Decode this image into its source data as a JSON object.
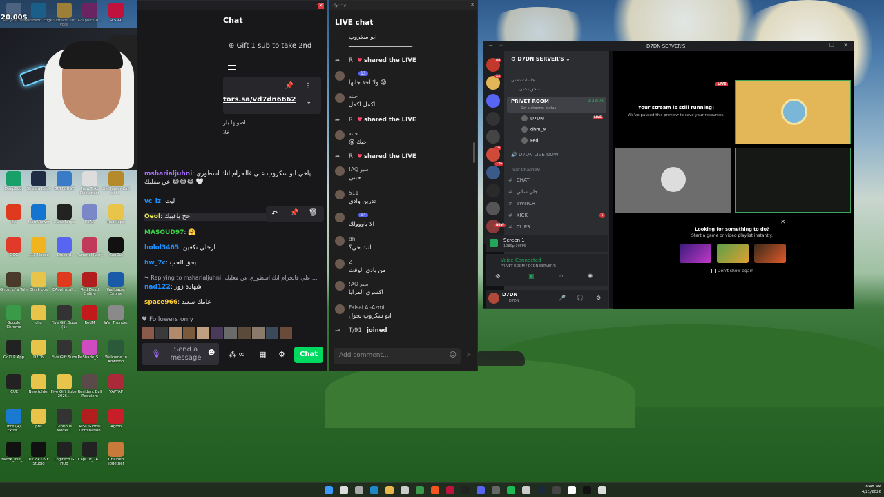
{
  "colors": {
    "chat_bg": "#18181b",
    "accent_green": "#00d95f",
    "twitch_purple": "#a970ff",
    "discord_bg": "#111214",
    "live_red": "#e0245e",
    "stream_yellow": "#e3b758"
  },
  "desktop": {
    "corner_overlay": "20.00$",
    "icons": [
      {
        "label": "Recycle Bin",
        "icon": "recycle-bin-icon",
        "color": "#6b8fb8"
      },
      {
        "label": "Microsoft Edge",
        "icon": "edge-icon",
        "color": "#1e88c9"
      },
      {
        "label": "Vidraclo em voce",
        "icon": "folder-icon",
        "color": "#e8b84a"
      },
      {
        "label": "Graphics-R...",
        "icon": "winrar-icon",
        "color": "#9b2c8c"
      },
      {
        "label": "SLS AC",
        "icon": "sls-icon",
        "color": "#c0123d"
      },
      {
        "label": "DeepCool",
        "icon": "deepcool-icon",
        "color": "#18a06a"
      },
      {
        "label": "Stream Deck",
        "icon": "streamdeck-icon",
        "color": "#202c44"
      },
      {
        "label": "GUFFBUST",
        "icon": "app-icon",
        "color": "#3a7bc8"
      },
      {
        "label": "New Text Document",
        "icon": "text-file-icon",
        "color": "#dddddd"
      },
      {
        "label": "theHunter Call of t...",
        "icon": "game-icon",
        "color": "#b58a2a"
      },
      {
        "label": "EA",
        "icon": "ea-icon",
        "color": "#e03a1e"
      },
      {
        "label": "TeamViewer",
        "icon": "teamviewer-icon",
        "color": "#1475d1"
      },
      {
        "label": "CurseForge",
        "icon": "curseforge-icon",
        "color": "#222222"
      },
      {
        "label": "PEAK",
        "icon": "peak-icon",
        "color": "#7a88c8"
      },
      {
        "label": "RedMapp",
        "icon": "folder-icon",
        "color": "#e8c44a"
      },
      {
        "label": "GCC",
        "icon": "gcc-icon",
        "color": "#e23a2a"
      },
      {
        "label": "X11 Mouse",
        "icon": "mouse-icon",
        "color": "#f2b41e"
      },
      {
        "label": "Discord",
        "icon": "discord-icon",
        "color": "#5865f2"
      },
      {
        "label": "Pummel Party",
        "icon": "game-icon",
        "color": "#c23a5a"
      },
      {
        "label": "CapCut",
        "icon": "capcut-icon",
        "color": "#111111"
      },
      {
        "label": "Ghost of a Tale",
        "icon": "game-icon",
        "color": "#4a3a2a"
      },
      {
        "label": "Black ops",
        "icon": "folder-icon",
        "color": "#e8c44a"
      },
      {
        "label": "EAppinstal...",
        "icon": "ea-icon",
        "color": "#e03a1e"
      },
      {
        "label": "Red Dead Online",
        "icon": "game-icon",
        "color": "#b01e1e"
      },
      {
        "label": "Wallpaper Engine",
        "icon": "wallpaper-icon",
        "color": "#1a5aa8"
      },
      {
        "label": "Google Chrome",
        "icon": "chrome-icon",
        "color": "#3a9a4a"
      },
      {
        "label": "clip",
        "icon": "folder-icon",
        "color": "#e8c44a"
      },
      {
        "label": "Five Gift Subs (1)",
        "icon": "video-icon",
        "color": "#333333"
      },
      {
        "label": "RedM",
        "icon": "redm-icon",
        "color": "#c21a1a"
      },
      {
        "label": "War Thunder",
        "icon": "game-icon",
        "color": "#8a8a8a"
      },
      {
        "label": "GoXLR App",
        "icon": "goxlr-icon",
        "color": "#222222"
      },
      {
        "label": "D7DN",
        "icon": "folder-icon",
        "color": "#e8c44a"
      },
      {
        "label": "Five Gift Subs",
        "icon": "video-icon",
        "color": "#333333"
      },
      {
        "label": "ReShade_S...",
        "icon": "reshade-icon",
        "color": "#d04ac0"
      },
      {
        "label": "Welcome to Kowloon",
        "icon": "game-icon",
        "color": "#2a5a3a"
      },
      {
        "label": "iCUE",
        "icon": "icue-icon",
        "color": "#222222"
      },
      {
        "label": "New folder",
        "icon": "folder-icon",
        "color": "#e8c44a"
      },
      {
        "label": "Five Gift Subs-2025...",
        "icon": "folder-icon",
        "color": "#e8c44a"
      },
      {
        "label": "Resident Evil Requiem",
        "icon": "game-icon",
        "color": "#5a4a4a"
      },
      {
        "label": "VAPYAP",
        "icon": "app-icon",
        "color": "#aa2a3a"
      },
      {
        "label": "Intel(R) Extre...",
        "icon": "intel-icon",
        "color": "#1a7ad1"
      },
      {
        "label": "pbs",
        "icon": "folder-icon",
        "color": "#e8c44a"
      },
      {
        "label": "Glorious Model...",
        "icon": "glorious-icon",
        "color": "#333333"
      },
      {
        "label": "RISK Global Domination",
        "icon": "risk-icon",
        "color": "#b01e1e"
      },
      {
        "label": "Agroo",
        "icon": "app-icon",
        "color": "#c81e2a"
      },
      {
        "label": "tiktok_live_...",
        "icon": "tiktok-icon",
        "color": "#111111"
      },
      {
        "label": "TikTok LIVE Studio",
        "icon": "tiktok-icon",
        "color": "#111111"
      },
      {
        "label": "Logitech G HUB",
        "icon": "ghub-icon",
        "color": "#222222"
      },
      {
        "label": "CapCut_76...",
        "icon": "capcut-icon",
        "color": "#222222"
      },
      {
        "label": "Chained Together",
        "icon": "game-icon",
        "color": "#c87a3a"
      }
    ]
  },
  "chat": {
    "title_rtl": "شات",
    "header": "Chat",
    "gift_banner": "Gift 1 sub to take 2nd",
    "pinned_link": "tors.sa/vd7dn6662",
    "partial_lines": [
      "اصولها بار",
      "خلا"
    ],
    "partial_stretch": "ـــــــــــــــــــــــــــــــــــ",
    "messages": [
      {
        "user": "msharialjuhni",
        "color": "#a970ff",
        "text": "ياخي ابو سكروب علي فالحرام انك اسطوري عن معليك 😂😂😂 🤍"
      },
      {
        "user": "vc_lz",
        "color": "#1e90ff",
        "text": "ليت"
      },
      {
        "user": "Oeol",
        "color": "#e8e84a",
        "text": "اخخ ياغبيك"
      },
      {
        "user": "MASOUD97",
        "color": "#3cd64a",
        "text": "🤗"
      },
      {
        "user": "holol3465",
        "color": "#1e90ff",
        "text": "ارحلي نكعين"
      },
      {
        "user": "hw_7c",
        "color": "#1e90ff",
        "text": "بحق الحب"
      },
      {
        "reply": "Replying to msharialjuhni: علي فالحرام انك اسطوري عن معليك ..."
      },
      {
        "user": "nad122",
        "color": "#1e90ff",
        "text": "شهادة زور"
      },
      {
        "user": "space966",
        "color": "#ffcc33",
        "text": "عامك سعيد"
      }
    ],
    "followers_only": "Followers only",
    "send_placeholder": "Send a message",
    "chat_button": "Chat",
    "points": "∞"
  },
  "live": {
    "title_rtl": "تيك توك",
    "header": "LIVE chat",
    "rows": [
      {
        "name": "",
        "text": "ابو سكروب",
        "sub": "ـــــــــــــــــــــــــــــــــــــ",
        "kind": "text"
      },
      {
        "name": "R",
        "text": "shared the LIVE",
        "kind": "share"
      },
      {
        "name": "",
        "badge": "13",
        "text": "ولا احد جابها 😡",
        "kind": "user"
      },
      {
        "name": "جبنه",
        "text": "اكمل اكمل",
        "kind": "user"
      },
      {
        "name": "R",
        "text": "shared the LIVE",
        "kind": "share"
      },
      {
        "name": "جبنه",
        "text": "@ حبك",
        "kind": "user"
      },
      {
        "name": "R",
        "text": "shared the LIVE",
        "kind": "share"
      },
      {
        "name": "!AQ سيو",
        "text": "حبنى",
        "kind": "user"
      },
      {
        "name": "511",
        "text": "تدرين وادي",
        "kind": "user"
      },
      {
        "name": "",
        "badge": "14",
        "text": "الا ياووولك",
        "kind": "user"
      },
      {
        "name": "dh",
        "text": "انت حي؟",
        "kind": "user"
      },
      {
        "name": "Z",
        "text": "من بادي الوقت",
        "kind": "user"
      },
      {
        "name": "!AQ سيو",
        "text": "اكسري المرايا",
        "kind": "user"
      },
      {
        "name": "Faisal Al-Azmi",
        "text": "ابو سكروب يحول",
        "sub": "ـــــــــــــــــــ",
        "kind": "user"
      },
      {
        "name": "T/91",
        "text": "joined",
        "kind": "join"
      }
    ],
    "comment_placeholder": "Add comment..."
  },
  "discord": {
    "title": "D7DN SERVER'S",
    "server_name": "D7DN SERVER'S",
    "categories": [
      "جلسات دحدن",
      "ملحق دحدن"
    ],
    "voice_channel": "PRIVET ROOM",
    "voice_timer": "2:23:08",
    "channel_status": "Set a channel status",
    "members": [
      {
        "name": "D7DN",
        "live": true
      },
      {
        "name": "dhm_9",
        "live": false
      },
      {
        "name": "Fed",
        "live": false
      }
    ],
    "live_now": "D7DN LIVE NOW",
    "text_channels_label": "Text Channels",
    "text_channels": [
      {
        "name": "CHAT",
        "badge": ""
      },
      {
        "name": "جلي سالي",
        "badge": ""
      },
      {
        "name": "TWITCH",
        "badge": ""
      },
      {
        "name": "KICK",
        "badge": "1"
      },
      {
        "name": "CLIPS",
        "badge": ""
      }
    ],
    "screen": {
      "title": "Screen 1",
      "sub": "1080p 30FPS"
    },
    "voice_connected": "Voice Connected",
    "voice_sub": "PRIVET ROOM / D7DN SERVER'S",
    "user": {
      "name": "D7DN",
      "status": "D7DN"
    },
    "stream_notice_title": "Your stream is still running!",
    "stream_notice_sub": "We've paused this preview to save your resources.",
    "live_badge": "LIVE",
    "promo_title": "Looking for something to do?",
    "promo_sub": "Start a game or video playlist instantly.",
    "dont_show": "Don't show again",
    "server_badges": [
      "88",
      "22",
      "16",
      "126",
      "NEW"
    ]
  },
  "taskbar": {
    "time": "8:48 AM",
    "date": "4/21/2026"
  }
}
